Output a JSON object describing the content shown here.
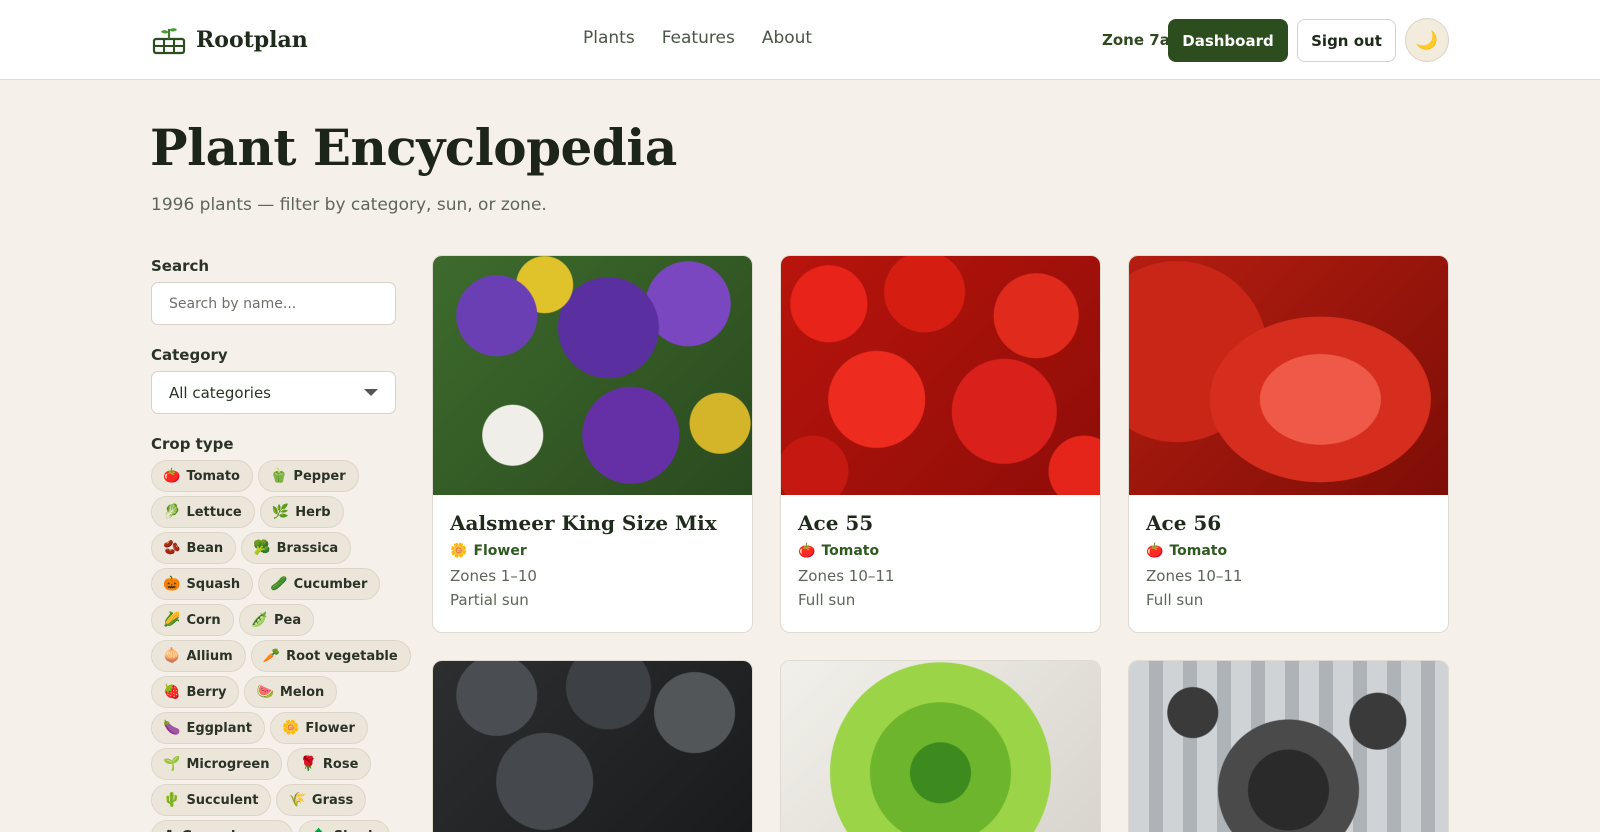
{
  "header": {
    "brand": "Rootplan",
    "nav": [
      "Plants",
      "Features",
      "About"
    ],
    "zone": "Zone 7a",
    "dashboard_label": "Dashboard",
    "signout_label": "Sign out",
    "theme_icon": "moon-icon"
  },
  "hero": {
    "title": "Plant Encyclopedia",
    "subtitle": "1996 plants — filter by category, sun, or zone."
  },
  "filters": {
    "search_label": "Search",
    "search_placeholder": "Search by name...",
    "category_label": "Category",
    "category_value": "All categories",
    "crop_label": "Crop type",
    "crops": [
      {
        "emoji": "🍅",
        "label": "Tomato"
      },
      {
        "emoji": "🫑",
        "label": "Pepper"
      },
      {
        "emoji": "🥬",
        "label": "Lettuce"
      },
      {
        "emoji": "🌿",
        "label": "Herb"
      },
      {
        "emoji": "🫘",
        "label": "Bean"
      },
      {
        "emoji": "🥦",
        "label": "Brassica"
      },
      {
        "emoji": "🎃",
        "label": "Squash"
      },
      {
        "emoji": "🥒",
        "label": "Cucumber"
      },
      {
        "emoji": "🌽",
        "label": "Corn"
      },
      {
        "emoji": "🫛",
        "label": "Pea"
      },
      {
        "emoji": "🧅",
        "label": "Allium"
      },
      {
        "emoji": "🥕",
        "label": "Root vegetable"
      },
      {
        "emoji": "🍓",
        "label": "Berry"
      },
      {
        "emoji": "🍉",
        "label": "Melon"
      },
      {
        "emoji": "🍆",
        "label": "Eggplant"
      },
      {
        "emoji": "🌼",
        "label": "Flower"
      },
      {
        "emoji": "🌱",
        "label": "Microgreen"
      },
      {
        "emoji": "🌹",
        "label": "Rose"
      },
      {
        "emoji": "🌵",
        "label": "Succulent"
      },
      {
        "emoji": "🌾",
        "label": "Grass"
      },
      {
        "emoji": "☘",
        "label": "Ground cover"
      },
      {
        "emoji": "🌲",
        "label": "Shrub"
      }
    ]
  },
  "plants": [
    {
      "name": "Aalsmeer King Size Mix",
      "emoji": "🌼",
      "category": "Flower",
      "zones": "Zones 1–10",
      "sun": "Partial sun"
    },
    {
      "name": "Ace 55",
      "emoji": "🍅",
      "category": "Tomato",
      "zones": "Zones 10–11",
      "sun": "Full sun"
    },
    {
      "name": "Ace 56",
      "emoji": "🍅",
      "category": "Tomato",
      "zones": "Zones 10–11",
      "sun": "Full sun"
    }
  ],
  "colors": {
    "accent": "#2c4d1e",
    "background": "#f5f1ea",
    "category_text": "#2f5a1f"
  }
}
